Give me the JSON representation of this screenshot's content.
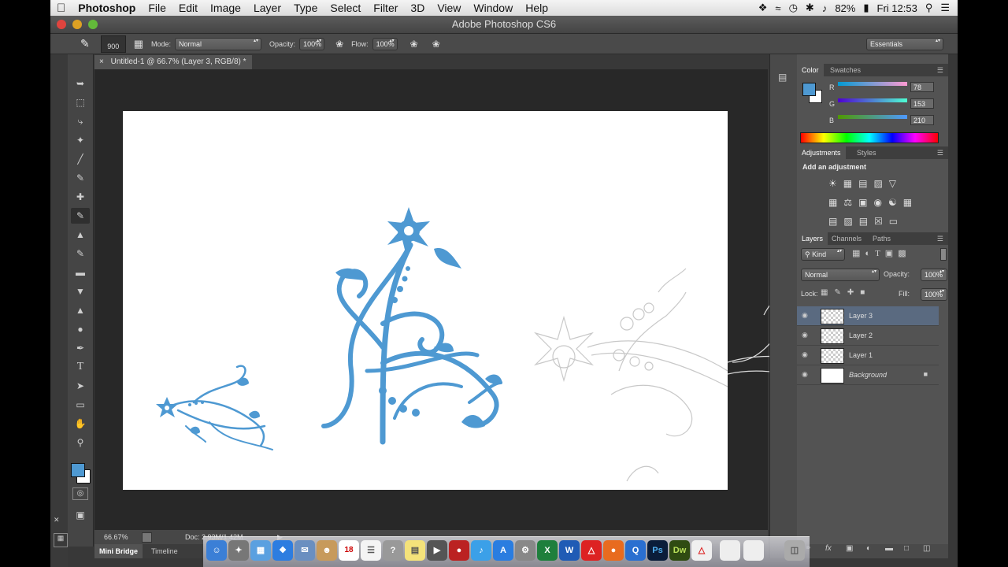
{
  "menubar": {
    "app": "Photoshop",
    "items": [
      "File",
      "Edit",
      "Image",
      "Layer",
      "Type",
      "Select",
      "Filter",
      "3D",
      "View",
      "Window",
      "Help"
    ],
    "battery": "82%",
    "clock": "Fri 12:53"
  },
  "window": {
    "title": "Adobe Photoshop CS6"
  },
  "options": {
    "brush_size": "900",
    "mode_label": "Mode:",
    "mode_value": "Normal",
    "opacity_label": "Opacity:",
    "opacity_value": "100%",
    "flow_label": "Flow:",
    "flow_value": "100%",
    "workspace": "Essentials"
  },
  "document": {
    "tab_title": "Untitled-1 @ 66.7% (Layer 3, RGB/8) *",
    "zoom": "66.67%",
    "doc_info": "Doc: 2.93M/1.42M"
  },
  "bottom_tabs": [
    "Mini Bridge",
    "Timeline"
  ],
  "color_panel": {
    "tabs": [
      "Color",
      "Swatches"
    ],
    "r_label": "R",
    "g_label": "G",
    "b_label": "B",
    "r": "78",
    "g": "153",
    "b": "210",
    "fg_color": "#4e99d2"
  },
  "adjustments_panel": {
    "tabs": [
      "Adjustments",
      "Styles"
    ],
    "heading": "Add an adjustment"
  },
  "layers_panel": {
    "tabs": [
      "Layers",
      "Channels",
      "Paths"
    ],
    "filter": "Kind",
    "blend": "Normal",
    "opacity_label": "Opacity:",
    "opacity": "100%",
    "lock_label": "Lock:",
    "fill_label": "Fill:",
    "fill": "100%",
    "layers": [
      {
        "name": "Layer 3"
      },
      {
        "name": "Layer 2"
      },
      {
        "name": "Layer 1"
      },
      {
        "name": "Background"
      }
    ]
  },
  "dock": {
    "calendar_day": "18"
  },
  "colors": {
    "accent": "#4e99d2"
  }
}
